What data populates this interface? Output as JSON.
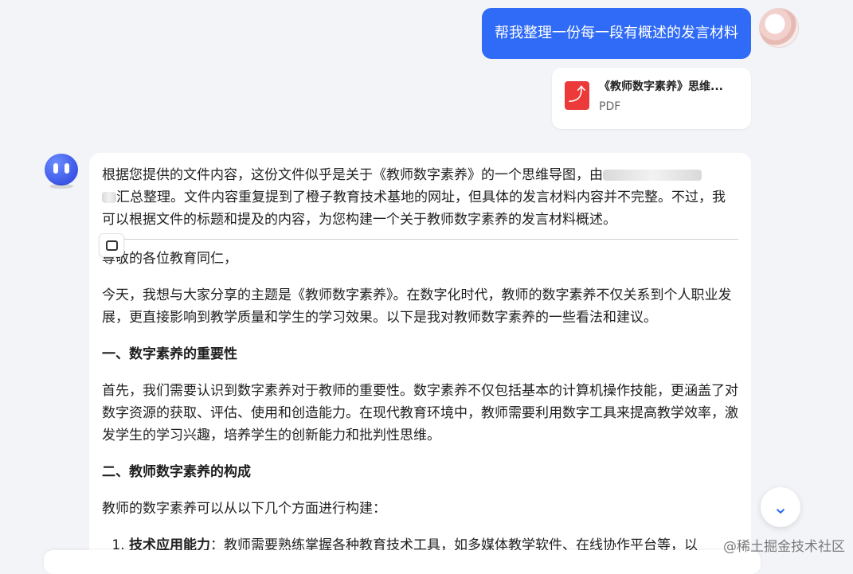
{
  "user_message": {
    "text": "帮我整理一份每一段有概述的发言材料"
  },
  "attachment": {
    "name": "《教师数字素养》思维...",
    "type": "PDF"
  },
  "assistant": {
    "intro_part1": "根据您提供的文件内容，这份文件似乎是关于《教师数字素养》的一个思维导图，由",
    "intro_part2": "汇总整理。文件内容重复提到了橙子教育技术基地的网址，但具体的发言材料内容并不完整。不过，我可以根据文件的标题和提及的内容，为您构建一个关于教师数字素养的发言材料概述。",
    "greeting": "尊敬的各位教育同仁，",
    "p_intro": "今天，我想与大家分享的主题是《教师数字素养》。在数字化时代，教师的数字素养不仅关系到个人职业发展，更直接影响到教学质量和学生的学习效果。以下是我对教师数字素养的一些看法和建议。",
    "h1": "一、数字素养的重要性",
    "p1": "首先，我们需要认识到数字素养对于教师的重要性。数字素养不仅包括基本的计算机操作技能，更涵盖了对数字资源的获取、评估、使用和创造能力。在现代教育环境中，教师需要利用数字工具来提高教学效率，激发学生的学习兴趣，培养学生的创新能力和批判性思维。",
    "h2": "二、教师数字素养的构成",
    "p2": "教师的数字素养可以从以下几个方面进行构建：",
    "list": [
      {
        "bold": "技术应用能力",
        "text": "：教师需要熟练掌握各种教育技术工具，如多媒体教学软件、在线协作平台等，以"
      }
    ]
  },
  "watermark": "@稀土掘金技术社区"
}
